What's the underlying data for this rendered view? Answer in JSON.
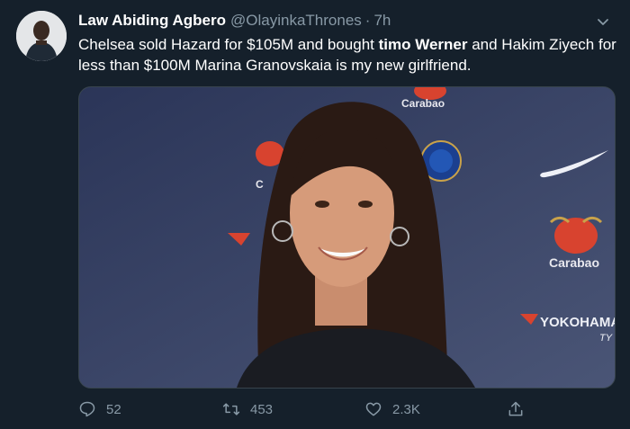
{
  "theme": {
    "background": "#15202b",
    "secondary_text": "#8899a6",
    "border": "#38444d"
  },
  "tweet": {
    "author_name": "Law Abiding Agbero",
    "handle": "@OlayinkaThrones",
    "separator": "·",
    "time": "7h",
    "text_part1": "Chelsea sold Hazard for $105M and bought ",
    "text_bold": "timo Werner",
    "text_part2": " and Hakim Ziyech for less than $100M  Marina Granovskaia is my new girlfriend."
  },
  "media": {
    "description_icon": "photo",
    "backdrop_logos": [
      "Carabao",
      "Carabao",
      "Carabao",
      "YOKOHAMA",
      "TY"
    ]
  },
  "actions": {
    "reply_count": "52",
    "retweet_count": "453",
    "like_count": "2.3K",
    "reply_icon": "reply-icon",
    "retweet_icon": "retweet-icon",
    "like_icon": "heart-icon",
    "share_icon": "share-icon"
  }
}
